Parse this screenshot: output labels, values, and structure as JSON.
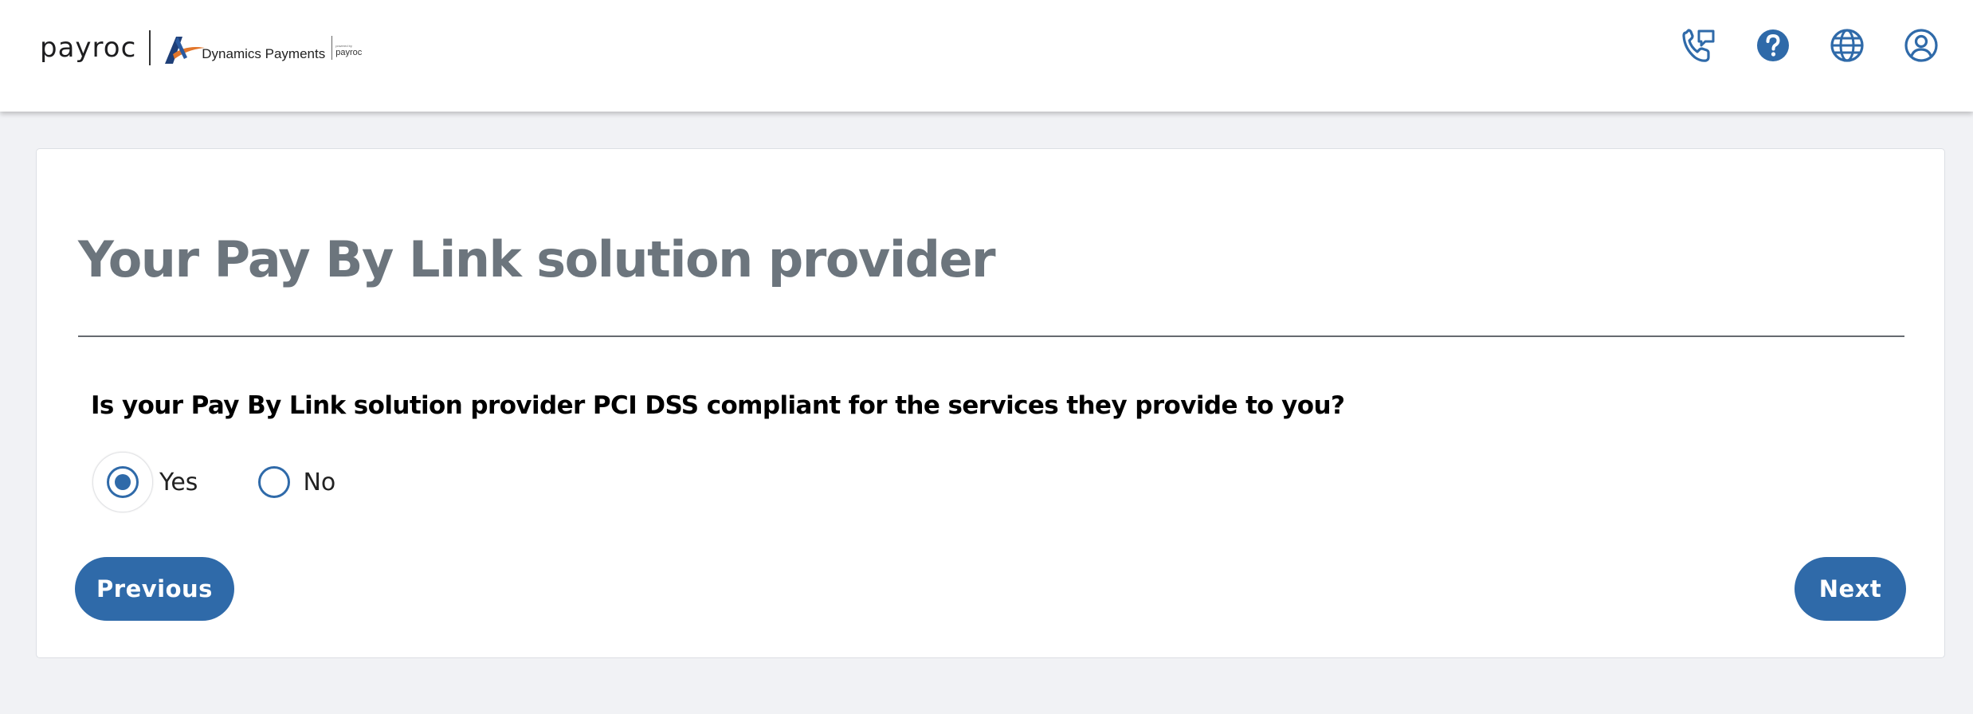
{
  "header": {
    "logo": {
      "brand": "payroc",
      "partner_name": "Dynamics Payments",
      "partner_sub_pre": "powered by",
      "partner_sub_brand": "payroc"
    },
    "icons": [
      "support-phone-icon",
      "help-icon",
      "language-globe-icon",
      "account-user-icon"
    ]
  },
  "main": {
    "title": "Your Pay By Link solution provider",
    "question": "Is your Pay By Link solution provider PCI DSS compliant for the services they provide to you?",
    "options": [
      {
        "label": "Yes",
        "selected": true
      },
      {
        "label": "No",
        "selected": false
      }
    ],
    "previous_label": "Previous",
    "next_label": "Next"
  },
  "colors": {
    "accent": "#2f6aa9",
    "title": "#6c757d",
    "background": "#f1f2f5"
  }
}
